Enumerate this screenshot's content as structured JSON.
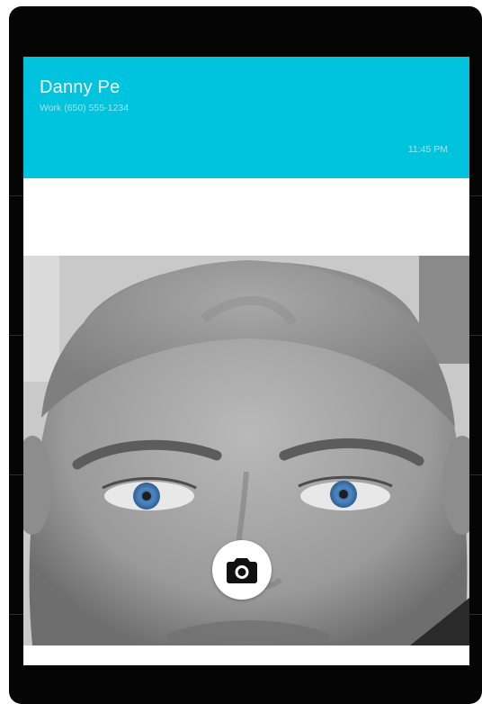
{
  "incoming_call": {
    "caller_name": "Danny Pe",
    "caller_number": "Work (650) 555-1234",
    "time": "11:45 PM"
  },
  "camera_button": {
    "icon": "camera-icon"
  },
  "colors": {
    "header_background": "#00c3dd",
    "device_frame": "#050505",
    "camera_button_background": "#ffffff",
    "eye_tint": "#4d86c2"
  }
}
